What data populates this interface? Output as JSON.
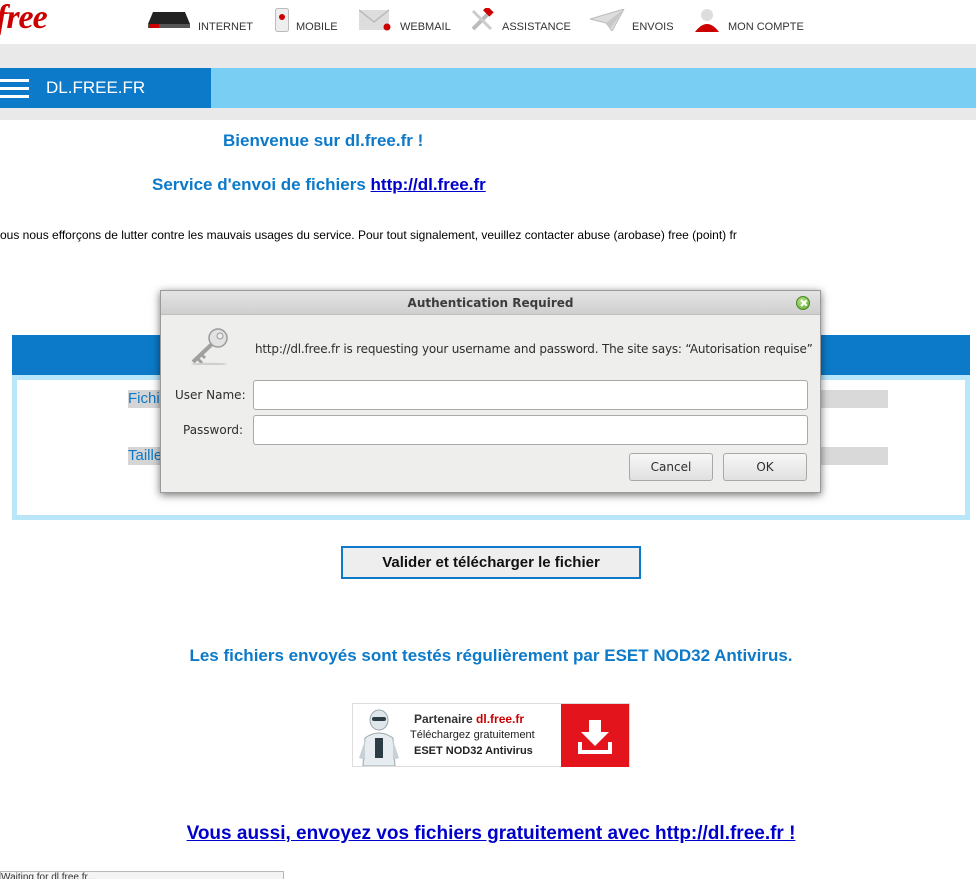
{
  "header": {
    "logo": "free",
    "nav": [
      {
        "label": "INTERNET",
        "icon": "box-icon"
      },
      {
        "label": "MOBILE",
        "icon": "phone-icon"
      },
      {
        "label": "WEBMAIL",
        "icon": "mail-icon"
      },
      {
        "label": "ASSISTANCE",
        "icon": "tools-icon"
      },
      {
        "label": "ENVOIS",
        "icon": "paper-plane-icon"
      },
      {
        "label": "MON COMPTE",
        "icon": "user-icon"
      }
    ]
  },
  "blueband": {
    "site_label": "DL.FREE.FR"
  },
  "main": {
    "welcome": "Bienvenue sur dl.free.fr !",
    "service_prefix": "Service d'envoi de fichiers ",
    "service_link": "http://dl.free.fr",
    "notice": "ous nous efforçons de lutter contre les mauvais usages du service. Pour tout signalement, veuillez contacter abuse (arobase) free (point) fr",
    "form": {
      "file_label": "Fichier",
      "size_label": "Taille",
      "submit_label": "Valider et télécharger le fichier"
    },
    "eset_text": "Les fichiers envoyés sont testés régulièrement par ESET NOD32 Antivirus.",
    "banner": {
      "partner_prefix": "Partenaire ",
      "partner_site": "dl.free.fr",
      "line2": "Téléchargez gratuitement",
      "line3": "ESET NOD32 Antivirus"
    },
    "bottom_link": "Vous aussi, envoyez vos fichiers gratuitement avec http://dl.free.fr !"
  },
  "statusbar": {
    "text": "Waiting for dl.free.fr..."
  },
  "dialog": {
    "title": "Authentication Required",
    "message": "http://dl.free.fr is requesting your username and password. The site says: “Autorisation requise”",
    "username_label": "User Name:",
    "password_label": "Password:",
    "username_value": "",
    "password_value": "",
    "cancel_label": "Cancel",
    "ok_label": "OK"
  },
  "colors": {
    "brand_red": "#cc0000",
    "free_blue": "#0c7ac9",
    "light_blue": "#79cef3",
    "link_blue": "#0000cc"
  }
}
